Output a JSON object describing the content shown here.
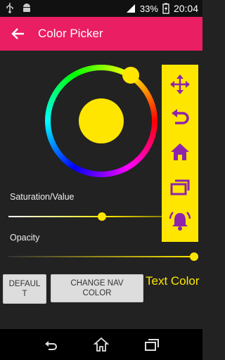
{
  "status_bar": {
    "battery_percent": "33%",
    "time": "20:04",
    "icons": [
      "usb-icon",
      "android-debug-icon",
      "signal-icon",
      "battery-charging-icon"
    ]
  },
  "app_bar": {
    "title": "Color Picker",
    "color": "#e91e63",
    "back_icon": "arrow-back-icon"
  },
  "picker": {
    "selected_color": "#ffe600",
    "saturation_value_label": "Saturation/Value",
    "saturation_value": 0.52,
    "opacity_label": "Opacity",
    "opacity": 1.0
  },
  "preview_toolbar": {
    "background": "#ffe600",
    "icon_color": "#8e24aa",
    "icons": [
      "move-arrows-icon",
      "undo-icon",
      "home-icon",
      "recent-apps-icon",
      "alarm-bell-icon"
    ]
  },
  "buttons": {
    "default_line1": "DEFAUL",
    "default_line2": "T",
    "change_nav_line1": "CHANGE NAV",
    "change_nav_line2": "COLOR"
  },
  "text_color_label": "Text Color",
  "nav_bar": {
    "icons": [
      "back-icon",
      "home-icon",
      "recents-icon"
    ]
  }
}
